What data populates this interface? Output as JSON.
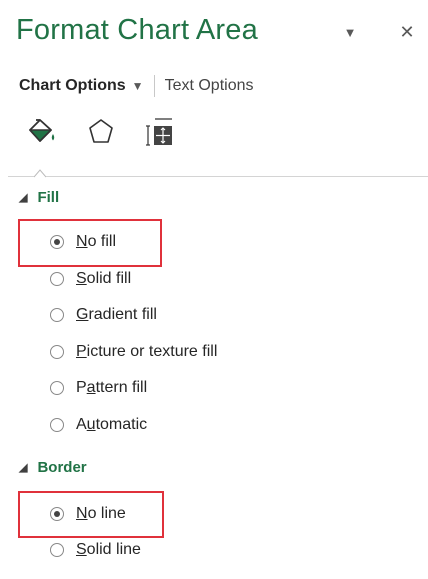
{
  "pane": {
    "title": "Format Chart Area",
    "collapse_glyph": "▼",
    "close_glyph": "✕"
  },
  "tabs": {
    "active": "Chart Options",
    "active_caret": "▼",
    "inactive": "Text Options"
  },
  "icons": [
    {
      "name": "fill-line-icon",
      "meaning": "Fill & Line"
    },
    {
      "name": "effects-pentagon-icon",
      "meaning": "Effects"
    },
    {
      "name": "size-properties-icon",
      "meaning": "Size & Properties"
    }
  ],
  "fill": {
    "section_label": "Fill",
    "options": [
      {
        "key": "N",
        "rest": "o fill",
        "selected": true
      },
      {
        "key": "S",
        "rest": "olid fill",
        "selected": false
      },
      {
        "key": "G",
        "rest": "radient fill",
        "selected": false
      },
      {
        "key": "P",
        "rest": "icture or texture fill",
        "selected": false
      },
      {
        "pre": "P",
        "key": "a",
        "rest": "ttern fill",
        "selected": false
      },
      {
        "pre": "A",
        "key": "u",
        "rest": "tomatic",
        "selected": false
      }
    ]
  },
  "border": {
    "section_label": "Border",
    "options": [
      {
        "key": "N",
        "rest": "o line",
        "selected": true
      },
      {
        "key": "S",
        "rest": "olid line",
        "selected": false
      }
    ]
  },
  "colors": {
    "accent": "#217346",
    "highlight": "#e0313b"
  }
}
